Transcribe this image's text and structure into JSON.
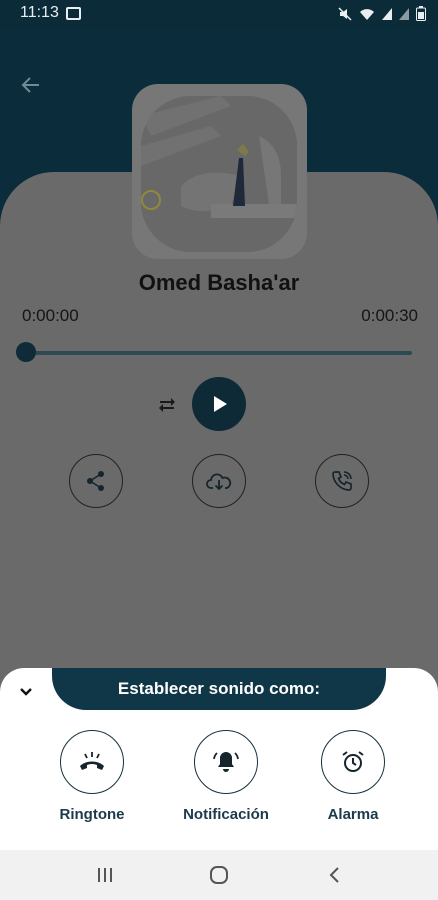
{
  "status_bar": {
    "time": "11:13",
    "icons": [
      "gallery-icon",
      "mute-icon",
      "wifi-icon",
      "signal-icon",
      "signal-icon",
      "battery-icon"
    ]
  },
  "header": {
    "back_icon": "arrow-left-icon"
  },
  "player": {
    "title": "Omed Basha'ar",
    "time_current": "0:00:00",
    "time_total": "0:00:30",
    "progress": 0.0,
    "controls": [
      "repeat-icon",
      "play-icon"
    ],
    "actions": [
      "share-icon",
      "cloud-download-icon",
      "phone-ring-icon"
    ]
  },
  "sheet": {
    "title": "Establecer sonido como:",
    "collapse_icon": "chevron-down-icon",
    "options": [
      {
        "label": "Ringtone",
        "icon": "phone-hangup-icon"
      },
      {
        "label": "Notificación",
        "icon": "bell-ring-icon"
      },
      {
        "label": "Alarma",
        "icon": "alarm-clock-icon"
      }
    ]
  },
  "navbar": {
    "items": [
      "recents-icon",
      "home-icon",
      "back-icon"
    ]
  },
  "colors": {
    "primary_dark": "#0d2a36",
    "overlay_gray": "#6a6a6a",
    "sheet_banner": "#103747",
    "label_text": "#1c3a4a"
  }
}
